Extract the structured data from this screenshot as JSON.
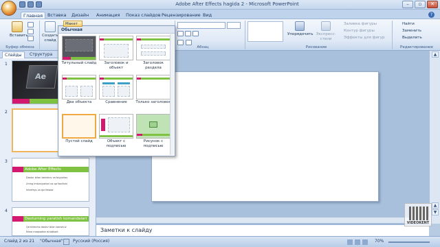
{
  "window": {
    "title": "Adobe After Effects hagida 2 - Microsoft PowerPoint",
    "controls": [
      "–",
      "▫",
      "✕"
    ]
  },
  "tabs": [
    "Главная",
    "Вставка",
    "Дизайн",
    "Анимация",
    "Показ слайдов",
    "Рецензирование",
    "Вид"
  ],
  "ribbon": {
    "clipboard": {
      "paste": "Вставить",
      "group": "Буфер обмена"
    },
    "slides": {
      "new_slide": "Создать слайд",
      "layout": "Макет"
    },
    "paragraph": {
      "group": "Абзац"
    },
    "drawing": {
      "arrange": "Упорядочить",
      "quick_styles": "Экспресс-стили",
      "fill": "Заливка фигуры",
      "outline": "Контур фигуры",
      "effects": "Эффекты для фигур",
      "group": "Рисование"
    },
    "editing": {
      "find": "Найти",
      "replace": "Заменить",
      "select": "Выделить",
      "group": "Редактирование"
    }
  },
  "layout_gallery": {
    "header": "Обычная",
    "items": [
      {
        "label": "Титульный слайд",
        "style": "title"
      },
      {
        "label": "Заголовок и объект",
        "style": "content"
      },
      {
        "label": "Заголовок раздела",
        "style": "section"
      },
      {
        "label": "Два объекта",
        "style": "two"
      },
      {
        "label": "Сравнение",
        "style": "compare"
      },
      {
        "label": "Только заголовок",
        "style": "titleonly"
      },
      {
        "label": "Пустой слайд",
        "style": "blank",
        "selected": true
      },
      {
        "label": "Объект с подписью",
        "style": "caption"
      },
      {
        "label": "Рисунок с подписью",
        "style": "picture"
      }
    ]
  },
  "slides_pane": {
    "tabs": [
      "Слайды",
      "Структура"
    ],
    "close": "×",
    "thumbs": [
      {
        "num": "1",
        "caption": "Ae"
      },
      {
        "num": "2",
        "caption": ""
      },
      {
        "num": "3",
        "caption": "Adobe After Effects",
        "bullets": [
          "Dastur bilan tanishuv va tayyorlov",
          "Uning imkoniyatlari va qo'llanilishi",
          "Interfeys va qurilmalar"
        ]
      },
      {
        "num": "4",
        "caption": "Dasturning yaratish komandalari",
        "bullets": [
          "Qo'shimcha dastur bilan tanishuv",
          "Nima maqsadda ishlatiladi"
        ]
      }
    ]
  },
  "notes": {
    "placeholder": "Заметки к слайду"
  },
  "statusbar": {
    "slide": "Слайд 2 из 21",
    "theme": "\"Обычная\"",
    "language": "Русский (Россия)",
    "zoom": "70%"
  },
  "watermark": {
    "text": "VIDEOKENT"
  },
  "colors": {
    "accent_green": "#7fc241",
    "accent_magenta": "#d2186f",
    "selection": "#f0a840"
  }
}
